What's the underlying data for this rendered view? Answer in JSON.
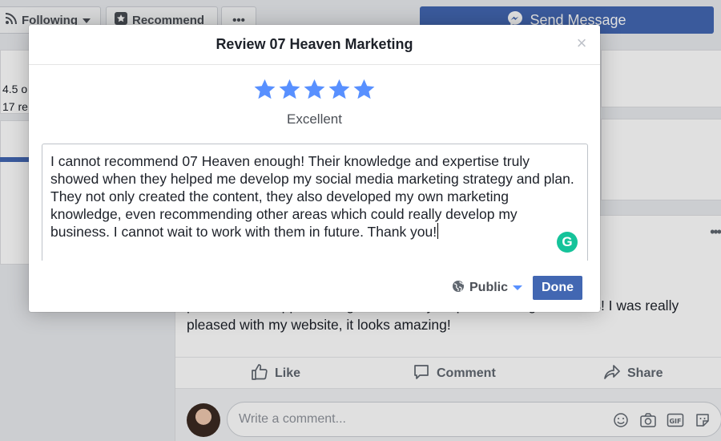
{
  "page_header": {
    "following_label": "Following",
    "recommend_label": "Recommend",
    "more_label": "•••",
    "send_message_label": "Send Message"
  },
  "sidebar": {
    "rating_line1": "4.5 o",
    "rating_line2": "17 re"
  },
  "post": {
    "text": "process and support was given at every step as I'm no good at this! I was really pleased with my website, it looks amazing!",
    "actions": {
      "like": "Like",
      "comment": "Comment",
      "share": "Share"
    },
    "comment_placeholder": "Write a comment...",
    "comment_icons": [
      "emoji-icon",
      "camera-icon",
      "gif-icon",
      "sticker-icon"
    ]
  },
  "modal": {
    "title": "Review 07 Heaven Marketing",
    "close_label": "×",
    "rating": {
      "stars": 5,
      "max": 5,
      "label": "Excellent",
      "color": "#5890ff"
    },
    "review_text": "I cannot recommend 07 Heaven enough! Their knowledge and expertise truly showed when they helped me develop my social media marketing strategy and plan. They not only created the content, they also developed my own marketing knowledge, even recommending other areas which could really develop my business. I cannot wait to work with them in future. Thank you!",
    "grammarly_label": "G",
    "audience_label": "Public",
    "done_label": "Done"
  },
  "colors": {
    "facebook_blue": "#4267b2",
    "grammarly_green": "#15c39a"
  }
}
